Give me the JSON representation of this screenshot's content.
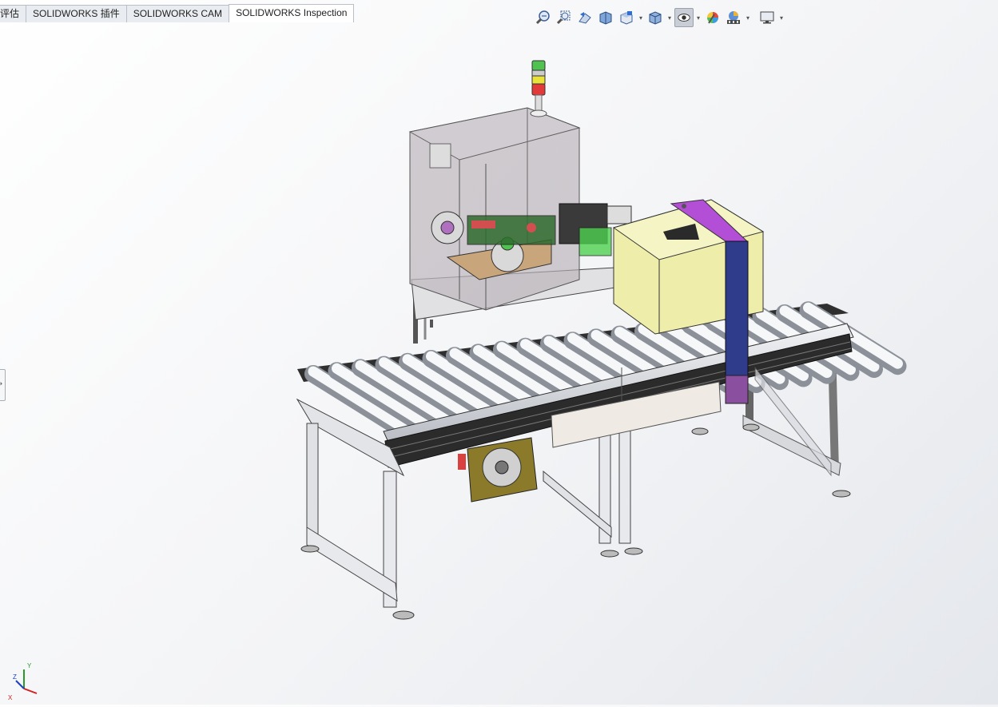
{
  "tabs": [
    {
      "label": "评估",
      "active": false
    },
    {
      "label": "SOLIDWORKS 插件",
      "active": false
    },
    {
      "label": "SOLIDWORKS CAM",
      "active": false
    },
    {
      "label": "SOLIDWORKS Inspection",
      "active": true
    }
  ],
  "headsup_toolbar": {
    "icons": [
      "zoom-to-fit-icon",
      "zoom-to-area-icon",
      "previous-view-icon",
      "section-view-icon",
      "view-orientation-icon",
      "display-style-icon",
      "hide-show-items-icon",
      "edit-appearance-icon",
      "apply-scene-icon",
      "view-settings-icon"
    ]
  },
  "triad": {
    "x_label": "X",
    "y_label": "Y",
    "z_label": "Z"
  },
  "colors": {
    "accent": "#2f3c8c",
    "magenta_part": "#b24fd6",
    "yellow_part": "#eeeeaa",
    "green_part": "#4fd14f"
  }
}
